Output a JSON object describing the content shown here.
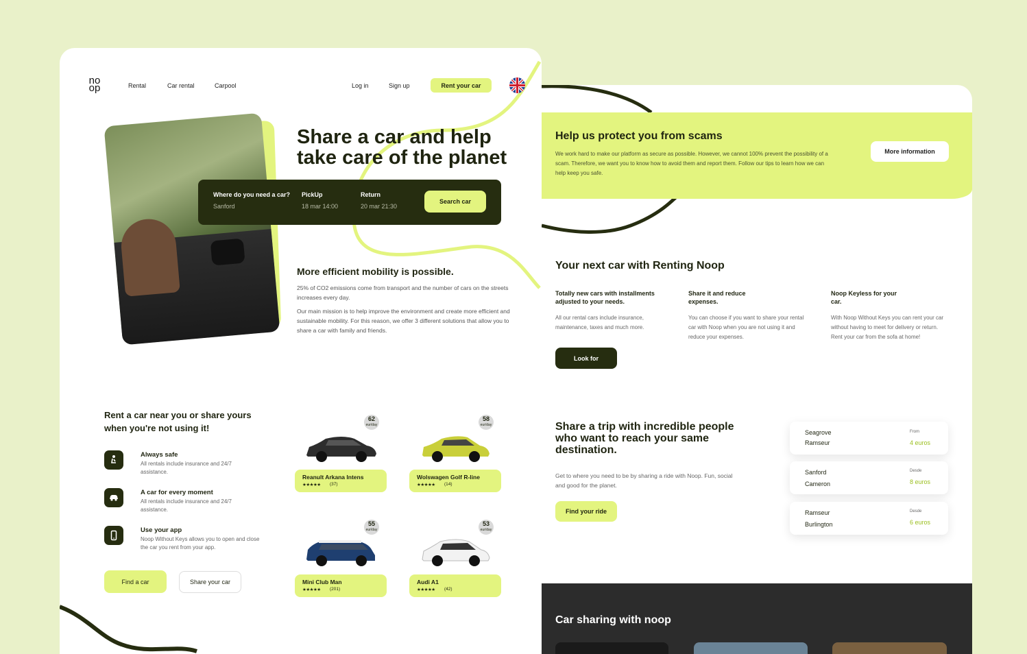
{
  "left": {
    "logo": {
      "top": "no",
      "bottom": "op"
    },
    "nav": {
      "rental": "Rental",
      "car_rental": "Car rental",
      "carpool": "Carpool",
      "login": "Log in",
      "signup": "Sign up",
      "rent_your_car": "Rent your car"
    },
    "hero": {
      "line1": "Share a car and help",
      "line2": "take care of the planet"
    },
    "search": {
      "where_label": "Where do you need a car?",
      "where_value": "Sanford",
      "pickup_label": "PickUp",
      "pickup_value": "18 mar 14:00",
      "return_label": "Return",
      "return_value": "20 mar 21:30",
      "button": "Search car"
    },
    "mobility": {
      "title": "More efficient mobility is possible.",
      "p1": "25% of CO2 emissions come from transport and the number of cars on the streets increases every day.",
      "p2": "Our main mission is to help improve the environment and create more efficient and sustainable mobility. For this reason, we offer 3 different solutions that allow you to share a car with family and friends."
    },
    "rent": {
      "title_l1": "Rent a car near you or share yours",
      "title_l2": "when you're not using it!",
      "features": [
        {
          "title": "Always safe",
          "desc": "All rentals include insurance and 24/7 assistance.",
          "icon": "car-seat-icon"
        },
        {
          "title": "A car for every moment",
          "desc": "All rentals include insurance and 24/7 assistance.",
          "icon": "car-icon"
        },
        {
          "title": "Use your app",
          "desc": "Noop Without Keys allows you to open and close the car you rent from your app.",
          "icon": "phone-icon"
        }
      ],
      "find_button": "Find a car",
      "share_button": "Share your car"
    },
    "cars": [
      {
        "name": "Reanult Arkana Intens",
        "price": "62",
        "unit": "eur/day",
        "rating": "★★★★★",
        "reviews": "(37)",
        "color": "#2d2d2d"
      },
      {
        "name": "Wolswagen Golf R-line",
        "price": "58",
        "unit": "eur/day",
        "rating": "★★★★★",
        "reviews": "(14)",
        "color": "#c9cf3a"
      },
      {
        "name": "Mini Club Man",
        "price": "55",
        "unit": "eur/day",
        "rating": "★★★★★",
        "reviews": "(201)",
        "color": "#1f3f70"
      },
      {
        "name": "Audi A1",
        "price": "53",
        "unit": "eur/day",
        "rating": "★★★★★",
        "reviews": "(42)",
        "color": "#f2f2f2"
      }
    ]
  },
  "right": {
    "scam": {
      "title": "Help us protect you from scams",
      "body": "We work hard to make our platform as secure as possible. However, we cannot 100% prevent the possibility of a scam. Therefore, we want you to know how to avoid them and report them. Follow our tips to learn how we can help keep you safe.",
      "button": "More information"
    },
    "renting": {
      "title": "Your next car with Renting Noop",
      "cols": [
        {
          "title": "Totally new cars with installments adjusted to your needs.",
          "body": "All our rental cars include insurance, maintenance, taxes and much more."
        },
        {
          "title": "Share it and reduce expenses.",
          "body": "You can choose if you want to share your rental car with Noop when you are not using it and reduce your expenses."
        },
        {
          "title": "Noop Keyless for your car.",
          "body": "With Noop Without Keys you can rent your car without having to meet for delivery or return. Rent your car from the sofa at home!"
        }
      ],
      "button": "Look for"
    },
    "trip": {
      "title": "Share a trip with incredible people who want to reach your same destination.",
      "body": "Get to where you need to be by sharing a ride with Noop. Fun, social and good for the planet.",
      "button": "Find your ride",
      "routes": [
        {
          "from": "Seagrove",
          "to": "Ramseur",
          "tag": "From",
          "price": "4 euros"
        },
        {
          "from": "Sanford",
          "to": "Cameron",
          "tag": "Desde",
          "price": "8 euros"
        },
        {
          "from": "Ramseur",
          "to": "Burlington",
          "tag": "Desde",
          "price": "6 euros"
        }
      ]
    },
    "sharing": {
      "title": "Car sharing with noop"
    }
  },
  "colors": {
    "accent": "#e3f47f",
    "dark": "#262d10",
    "price": "#9bbf1f"
  }
}
